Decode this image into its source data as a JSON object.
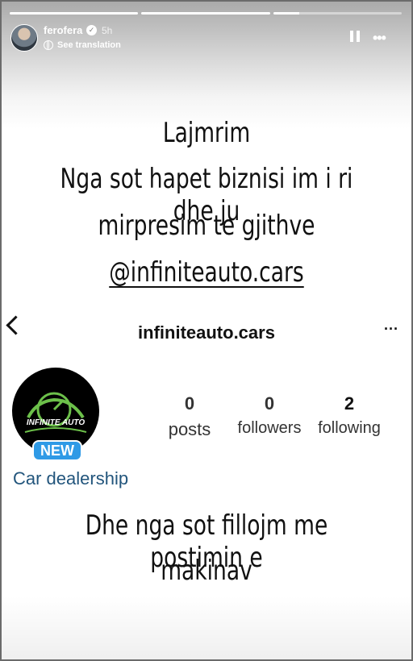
{
  "story": {
    "progress": [
      1,
      1,
      0.2
    ],
    "username": "ferofera",
    "time": "5h",
    "see_translation": "See translation",
    "icons": [
      "globe-icon",
      "verified-icon",
      "pause-icon",
      "more-icon"
    ]
  },
  "announcement": {
    "title": "Lajmrim",
    "line1": "Nga sot hapet biznisi im i ri dhe ju",
    "line2": "mirpresim te gjithve",
    "mention": "@infiniteauto.cars"
  },
  "profile": {
    "name": "infiniteauto.cars",
    "logo_text": "INFINITE AUTO",
    "badge": "NEW",
    "stats": [
      {
        "value": "0",
        "label": "posts"
      },
      {
        "value": "0",
        "label": "followers"
      },
      {
        "value": "2",
        "label": "following"
      }
    ],
    "category": "Car dealership"
  },
  "bottom_text": {
    "line1": "Dhe nga sot fillojm me postimin e",
    "line2": "makinav"
  },
  "colors": {
    "logo_green": "#6cc04a",
    "badge_blue": "#2f9ae6",
    "category_blue": "#22557c"
  }
}
